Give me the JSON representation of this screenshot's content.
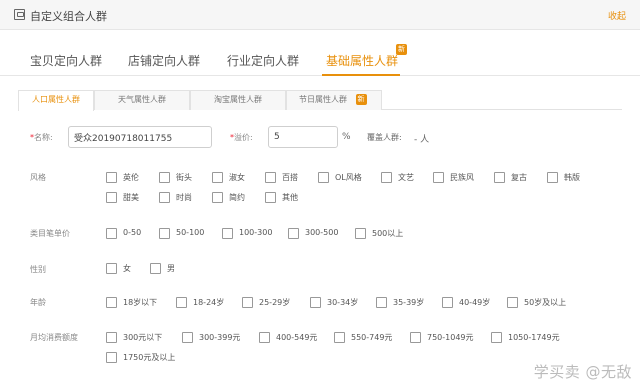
{
  "header": {
    "title": "自定义组合人群",
    "collapse_label": "收起"
  },
  "main_tabs": [
    {
      "label": "宝贝定向人群"
    },
    {
      "label": "店铺定向人群"
    },
    {
      "label": "行业定向人群"
    },
    {
      "label": "基础属性人群",
      "badge": "新"
    }
  ],
  "sub_tabs": [
    {
      "label": "人口属性人群"
    },
    {
      "label": "天气属性人群"
    },
    {
      "label": "淘宝属性人群"
    },
    {
      "label": "节日属性人群",
      "badge": "新"
    }
  ],
  "form": {
    "name_label": "名称:",
    "name_value": "受众20190718011755",
    "premium_label": "溢价:",
    "premium_value": "5",
    "premium_unit": "%",
    "coverage_label": "覆盖人群:",
    "coverage_value": "- 人",
    "required_mark": "*"
  },
  "rows": {
    "style": {
      "label": "风格",
      "options": [
        "英伦",
        "街头",
        "淑女",
        "百搭",
        "OL风格",
        "文艺",
        "民族风",
        "复古",
        "韩版",
        "甜美",
        "时尚",
        "简约",
        "其他"
      ]
    },
    "price": {
      "label": "类目笔单价",
      "options": [
        "0-50",
        "50-100",
        "100-300",
        "300-500",
        "500以上"
      ]
    },
    "gender": {
      "label": "性别",
      "options": [
        "女",
        "男"
      ]
    },
    "age": {
      "label": "年龄",
      "options": [
        "18岁以下",
        "18-24岁",
        "25-29岁",
        "30-34岁",
        "35-39岁",
        "40-49岁",
        "50岁及以上"
      ]
    },
    "spend": {
      "label": "月均消费额度",
      "options": [
        "300元以下",
        "300-399元",
        "400-549元",
        "550-749元",
        "750-1049元",
        "1050-1749元",
        "1750元及以上"
      ]
    }
  },
  "watermark": "学买卖 @无敌",
  "colors": {
    "accent": "#e8900c",
    "required": "#e22233"
  }
}
